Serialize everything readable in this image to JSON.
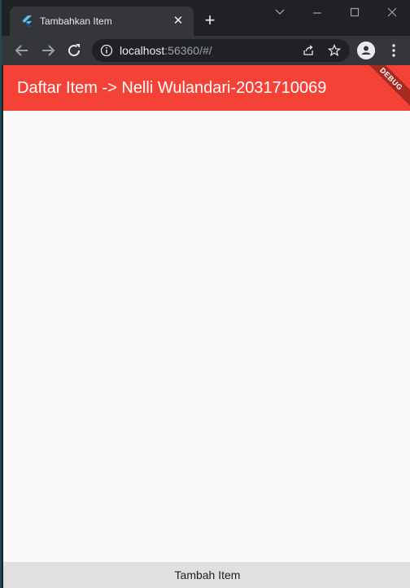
{
  "browser": {
    "tab": {
      "title": "Tambahkan Item",
      "favicon": "flutter-icon",
      "close_glyph": "✕"
    },
    "new_tab_glyph": "+",
    "window_controls": [
      "minimize-icon",
      "maximize-icon",
      "close-icon"
    ],
    "address": {
      "host": "localhost",
      "rest": ":56360/#/"
    },
    "toolbar_icons": [
      "back-icon",
      "forward-icon",
      "reload-icon",
      "info-icon",
      "share-icon",
      "star-icon",
      "profile-icon",
      "menu-icon"
    ]
  },
  "app": {
    "appbar_title": "Daftar Item -> Nelli Wulandari-2031710069",
    "debug_banner": "DEBUG",
    "bottom_button": "Tambah Item",
    "colors": {
      "appbar": "#f44336",
      "background": "#fafafa",
      "bottom_button": "#e0e0e0"
    }
  }
}
